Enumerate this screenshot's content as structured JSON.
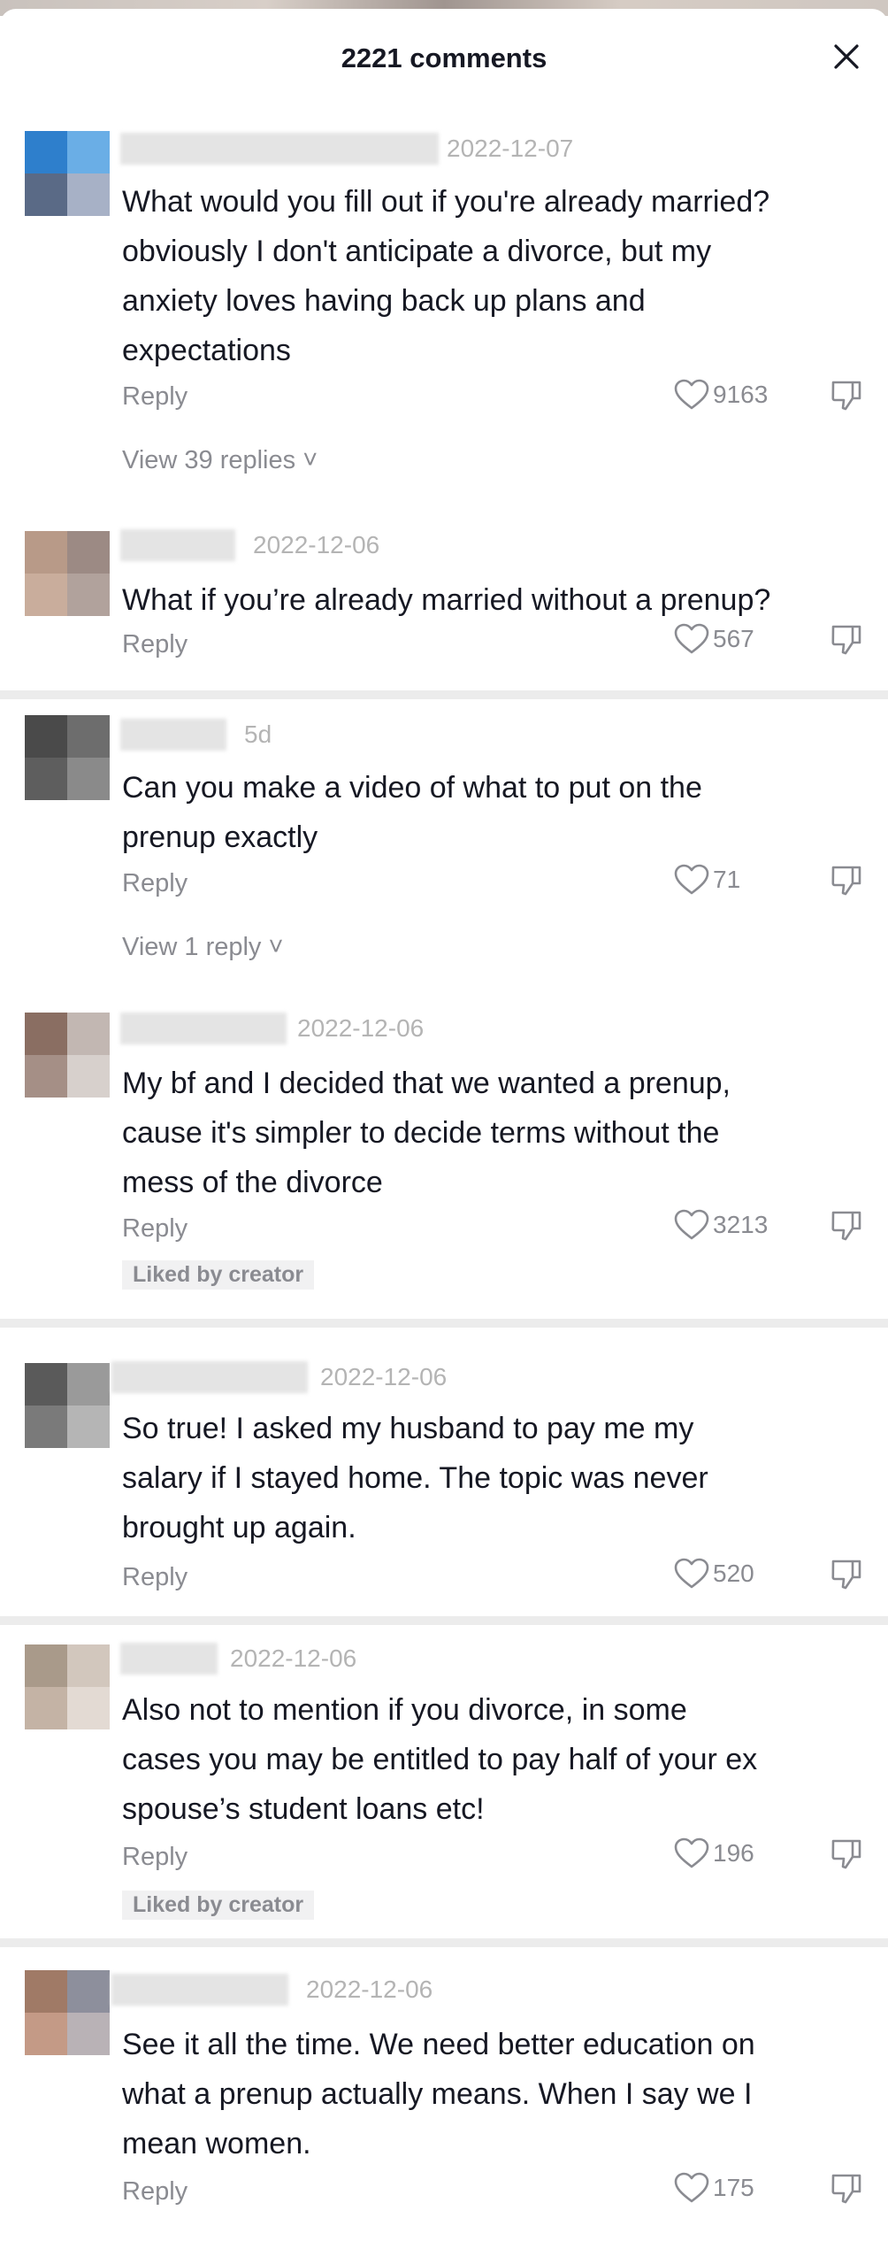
{
  "header": {
    "title": "2221 comments"
  },
  "comments": [
    {
      "date": "2022-12-07",
      "lines": [
        "What would you fill out if you're already married?",
        "obviously I don't anticipate a divorce, but my",
        "anxiety loves having back up plans and",
        "expectations"
      ],
      "reply": "Reply",
      "likes": "9163",
      "view_replies": "View 39 replies",
      "badge": "",
      "avatar_colors": [
        "#2e7fcc",
        "#6aaee6",
        "#5a6a86",
        "#a7b1c6"
      ]
    },
    {
      "date": "2022-12-06",
      "lines": [
        "What if you’re already married without a prenup?"
      ],
      "reply": "Reply",
      "likes": "567",
      "view_replies": "",
      "badge": "",
      "avatar_colors": [
        "#b89a88",
        "#9c8a84",
        "#c9ad9c",
        "#b1a29c"
      ]
    },
    {
      "date": "5d",
      "lines": [
        "Can you make a video of what to put on the",
        "prenup exactly"
      ],
      "reply": "Reply",
      "likes": "71",
      "view_replies": "View 1 reply",
      "badge": "",
      "avatar_colors": [
        "#4a4a4a",
        "#6d6d6d",
        "#5e5e5e",
        "#8a8a8a"
      ]
    },
    {
      "date": "2022-12-06",
      "lines": [
        "My bf and I decided that we wanted a prenup,",
        "cause it's simpler to decide terms without the",
        "mess of the divorce"
      ],
      "reply": "Reply",
      "likes": "3213",
      "view_replies": "",
      "badge": "Liked by creator",
      "avatar_colors": [
        "#8a6e62",
        "#c2b7b2",
        "#a58f86",
        "#d7d0cc"
      ]
    },
    {
      "date": "2022-12-06",
      "lines": [
        "So true! I asked my husband to pay me my",
        "salary if I stayed home. The topic was never",
        "brought up again."
      ],
      "reply": "Reply",
      "likes": "520",
      "view_replies": "",
      "badge": "",
      "avatar_colors": [
        "#5a5a5a",
        "#9a9a9a",
        "#7a7a7a",
        "#b5b5b5"
      ]
    },
    {
      "date": "2022-12-06",
      "lines": [
        "Also not to mention if you divorce, in some",
        "cases you may be entitled to pay half of your ex",
        "spouse’s student loans etc!"
      ],
      "reply": "Reply",
      "likes": "196",
      "view_replies": "",
      "badge": "Liked by creator",
      "avatar_colors": [
        "#a99a8a",
        "#d2c7bd",
        "#c4b3a5",
        "#e3dad3"
      ]
    },
    {
      "date": "2022-12-06",
      "lines": [
        "See it all the time. We need better education on",
        "what a prenup actually means. When I say we I",
        "mean women."
      ],
      "reply": "Reply",
      "likes": "175",
      "view_replies": "",
      "badge": "",
      "avatar_colors": [
        "#a07a66",
        "#8d8f9c",
        "#c49a86",
        "#b9b2b6"
      ]
    }
  ]
}
